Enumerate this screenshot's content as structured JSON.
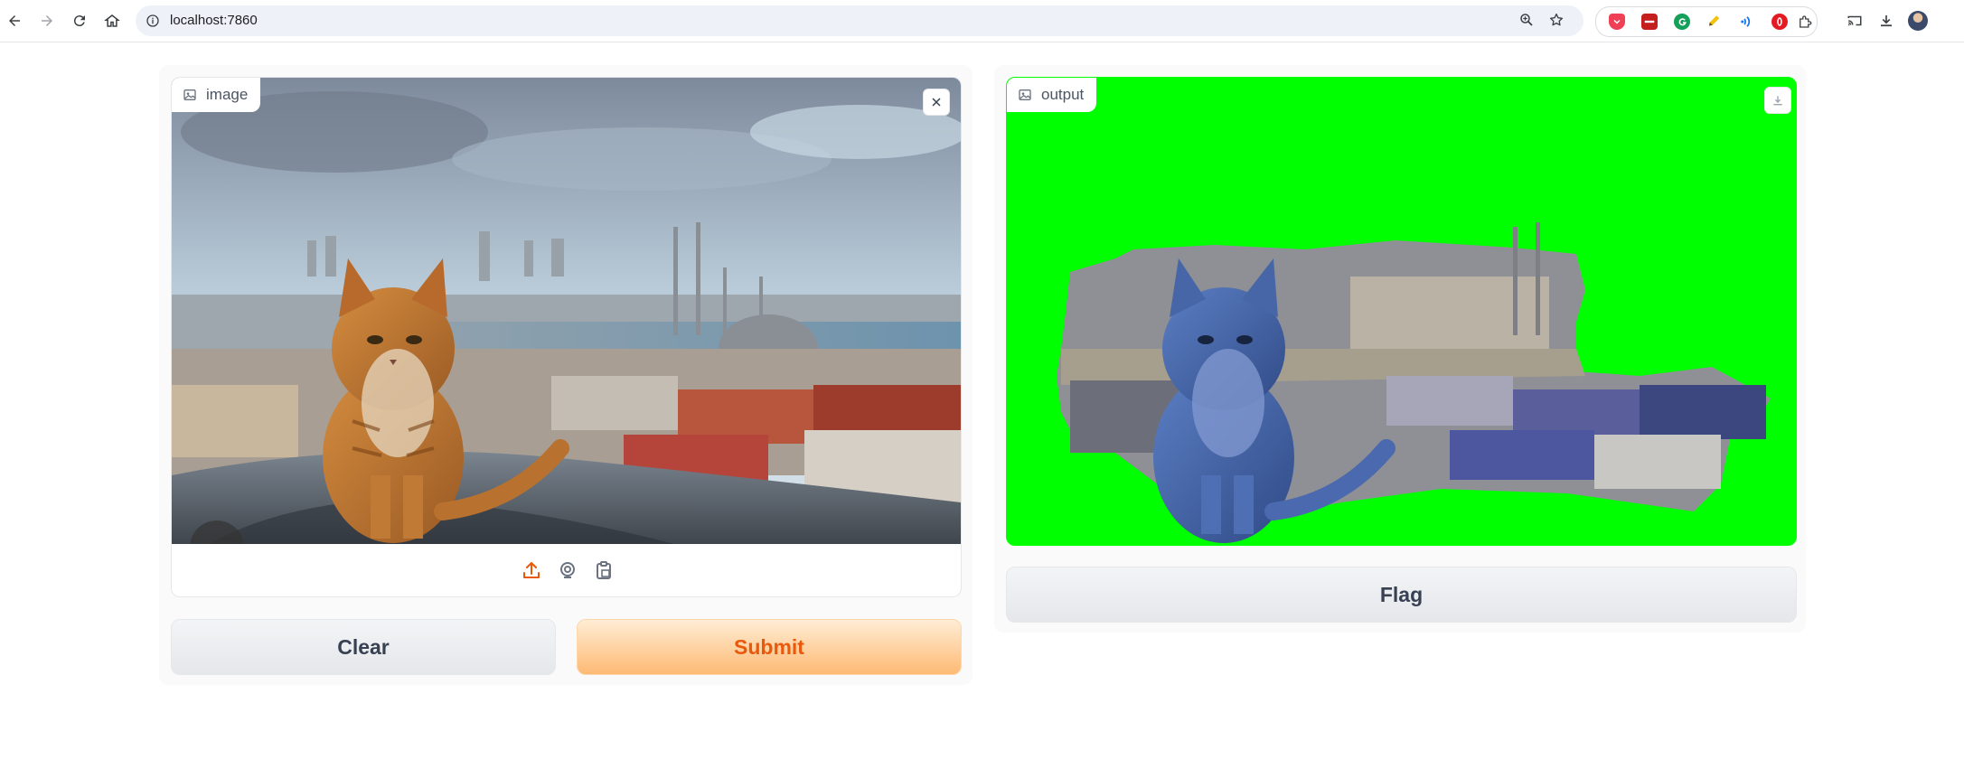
{
  "browser": {
    "url": "localhost:7860",
    "icons": {
      "back": "back-arrow-icon",
      "forward": "forward-arrow-icon",
      "reload": "reload-icon",
      "home": "home-icon",
      "site_info": "site-info-icon",
      "zoom": "zoom-icon",
      "bookmark": "star-icon",
      "cast": "cast-icon",
      "downloads": "download-icon",
      "profile": "avatar"
    },
    "extensions": [
      "pocket-icon",
      "red-extension-icon",
      "grammarly-icon",
      "highlighter-icon",
      "audio-extension-icon",
      "opera-icon",
      "puzzle-icon"
    ]
  },
  "input_panel": {
    "image_label": "image",
    "source_icons": [
      "upload-icon",
      "webcam-icon",
      "clipboard-icon"
    ],
    "clear_label": "Clear",
    "submit_label": "Submit",
    "colors": {
      "accent": "#ea580c",
      "primary_bg": "#fdba74"
    }
  },
  "output_panel": {
    "image_label": "output",
    "flag_label": "Flag",
    "background_color": "#00ff00"
  }
}
